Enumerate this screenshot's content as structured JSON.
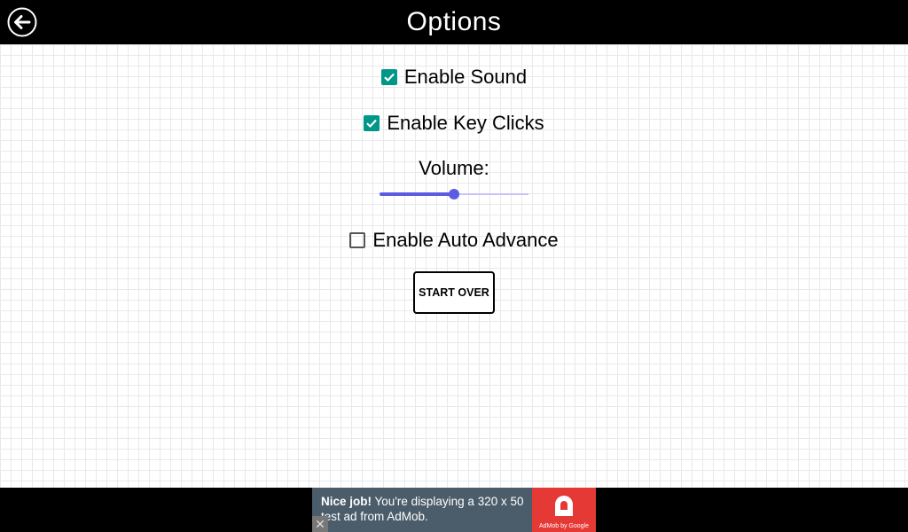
{
  "header": {
    "title": "Options",
    "back_icon": "arrow-left-circle-icon"
  },
  "options": {
    "enable_sound": {
      "label": "Enable Sound",
      "checked": true
    },
    "enable_key_clicks": {
      "label": "Enable Key Clicks",
      "checked": true
    },
    "volume": {
      "label": "Volume:",
      "value": 0.5
    },
    "enable_auto_advance": {
      "label": "Enable Auto Advance",
      "checked": false
    }
  },
  "actions": {
    "start_over_label": "START OVER"
  },
  "ad": {
    "headline": "Nice job!",
    "body": "You're displaying a 320 x 50 test ad from AdMob.",
    "close_glyph": "✕",
    "logo_caption": "AdMob by Google"
  },
  "colors": {
    "topbar": "#000000",
    "checkbox_checked": "#009688",
    "slider_accent": "#5b5ce2",
    "ad_background": "#4b5d6b",
    "ad_logo": "#e53935"
  }
}
